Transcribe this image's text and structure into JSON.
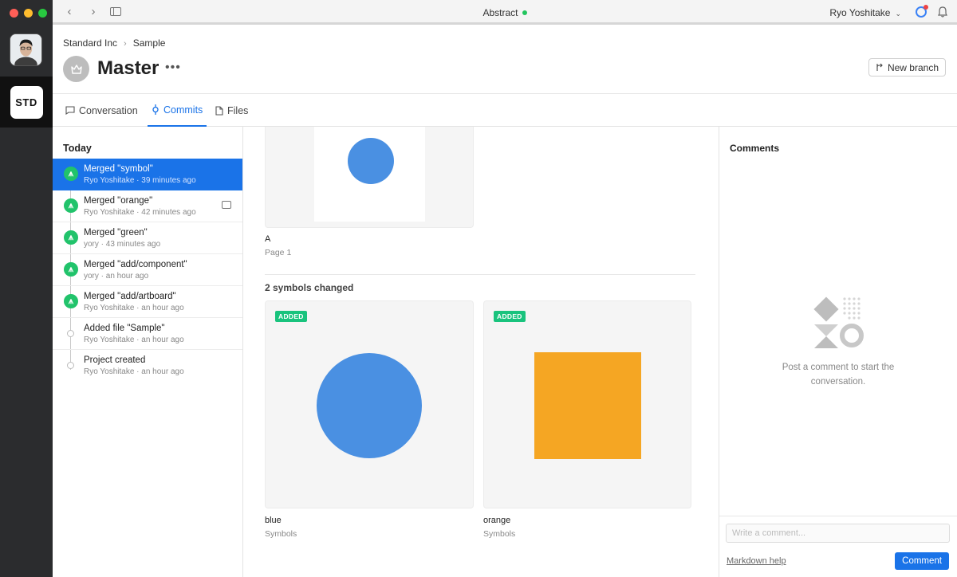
{
  "window": {
    "title": "Abstract",
    "status_color": "#22c55e",
    "user": "Ryo Yoshitake"
  },
  "rail": {
    "org_label": "STD"
  },
  "breadcrumb": {
    "org": "Standard Inc",
    "project": "Sample"
  },
  "branch": {
    "title": "Master",
    "more": "•••",
    "new_branch_label": "New branch"
  },
  "tabs": [
    {
      "label": "Conversation",
      "icon": "speech-bubble-icon",
      "active": false
    },
    {
      "label": "Commits",
      "icon": "commit-icon",
      "active": true
    },
    {
      "label": "Files",
      "icon": "file-icon",
      "active": false
    }
  ],
  "commits": {
    "group_label": "Today",
    "items": [
      {
        "message": "Merged \"symbol\"",
        "meta": "Ryo Yoshitake · 39 minutes ago",
        "type": "merge",
        "selected": true
      },
      {
        "message": "Merged \"orange\"",
        "meta": "Ryo Yoshitake · 42 minutes ago",
        "type": "merge",
        "has_comment": true
      },
      {
        "message": "Merged \"green\"",
        "meta": "yory · 43 minutes ago",
        "type": "merge"
      },
      {
        "message": "Merged \"add/component\"",
        "meta": "yory · an hour ago",
        "type": "merge"
      },
      {
        "message": "Merged \"add/artboard\"",
        "meta": "Ryo Yoshitake · an hour ago",
        "type": "merge"
      },
      {
        "message": "Added file \"Sample\"",
        "meta": "Ryo Yoshitake · an hour ago",
        "type": "file"
      },
      {
        "message": "Project created",
        "meta": "Ryo Yoshitake · an hour ago",
        "type": "file"
      }
    ]
  },
  "main": {
    "artboard": {
      "name": "A",
      "page": "Page 1",
      "shape_color": "#4a90e2"
    },
    "symbols_heading": "2 symbols changed",
    "symbols": [
      {
        "name": "blue",
        "group": "Symbols",
        "badge": "ADDED",
        "shape": "circle",
        "color": "#4a90e2"
      },
      {
        "name": "orange",
        "group": "Symbols",
        "badge": "ADDED",
        "shape": "square",
        "color": "#f5a623"
      }
    ]
  },
  "comments": {
    "title": "Comments",
    "empty_text": "Post a comment to start the conversation.",
    "input_placeholder": "Write a comment...",
    "markdown_help": "Markdown help",
    "submit_label": "Comment"
  }
}
